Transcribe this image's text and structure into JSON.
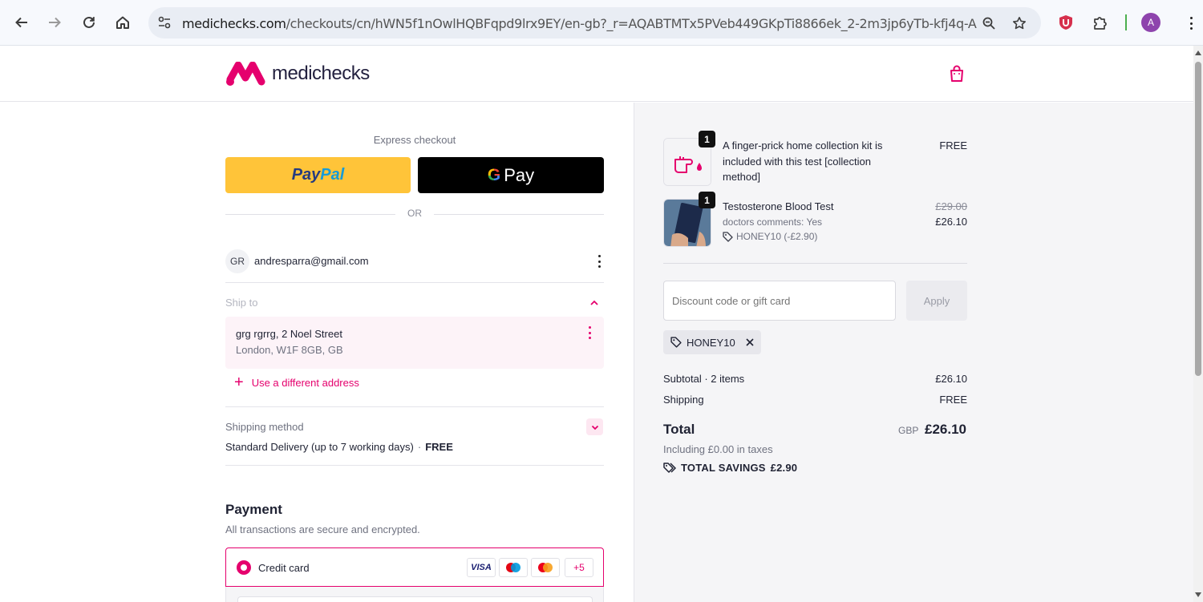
{
  "browser": {
    "url_host": "medichecks.com",
    "url_path": "/checkouts/cn/hWN5f1nOwlHQBFqpd9lrx9EY/en-gb?_r=AQABTMTx5PVeb449GKpTi8866ek_2-2m3jp6yTb-kfj4q-A",
    "extension_avatar_label": "A"
  },
  "header": {
    "logo_text": "medichecks"
  },
  "checkout": {
    "express_label": "Express checkout",
    "paypal_label_a": "Pay",
    "paypal_label_b": "Pal",
    "gpay_label": "Pay",
    "or_label": "OR",
    "account": {
      "initials": "GR",
      "email": "andresparra@gmail.com"
    },
    "ship_to_label": "Ship to",
    "address_line1": "grg rgrrg, 2 Noel Street",
    "address_line2": "London, W1F 8GB, GB",
    "use_different_address": "Use a different address",
    "shipping_method_label": "Shipping method",
    "shipping_method_value": "Standard Delivery (up to 7 working days)",
    "shipping_method_sep": "·",
    "shipping_method_price": "FREE",
    "payment_title": "Payment",
    "payment_sub": "All transactions are secure and encrypted.",
    "credit_card_label": "Credit card",
    "card_brands": [
      "VISA",
      "+5"
    ]
  },
  "summary": {
    "items": [
      {
        "qty": "1",
        "title": "A finger-prick home collection kit is included with this test [collection method]",
        "price": "FREE"
      },
      {
        "qty": "1",
        "title": "Testosterone Blood Test",
        "subtitle": "doctors comments: Yes",
        "code": "HONEY10 (-£2.90)",
        "original_price": "£29.00",
        "price": "£26.10"
      }
    ],
    "discount_placeholder": "Discount code or gift card",
    "apply_label": "Apply",
    "applied_code": "HONEY10",
    "subtotal_label": "Subtotal · 2 items",
    "subtotal_value": "£26.10",
    "shipping_label": "Shipping",
    "shipping_value": "FREE",
    "total_label": "Total",
    "total_currency": "GBP",
    "total_value": "£26.10",
    "tax_note": "Including £0.00 in taxes",
    "savings_label": "TOTAL SAVINGS",
    "savings_value": "£2.90"
  },
  "colors": {
    "brand_pink": "#e5006d",
    "paypal_yellow": "#ffc439",
    "summary_bg": "#f5f5f7"
  }
}
